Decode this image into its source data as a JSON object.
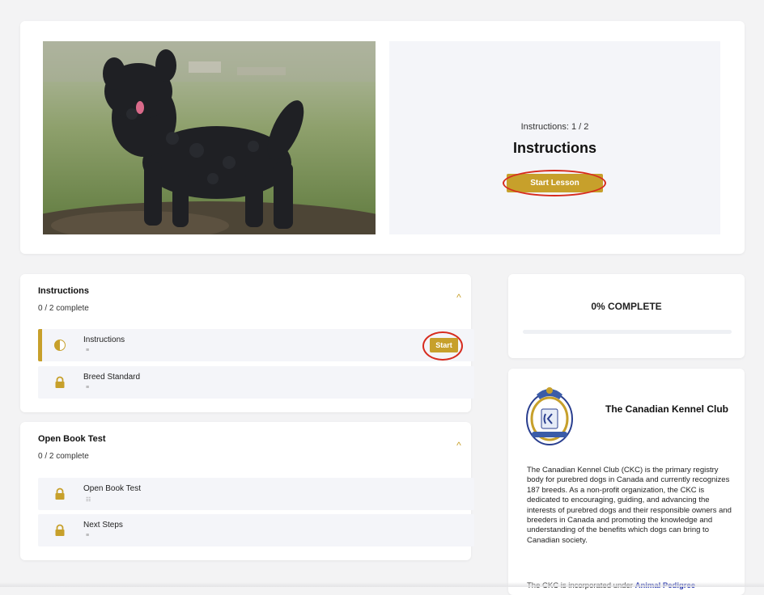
{
  "hero": {
    "image_alt": "curly black dog standing on grassy hillside",
    "lesson_counter": "Instructions: 1 / 2",
    "lesson_title": "Instructions",
    "start_lesson_label": "Start Lesson"
  },
  "sections": [
    {
      "title": "Instructions",
      "count": "0 / 2 complete",
      "items": [
        {
          "title": "Instructions",
          "status_icon": "half-circle-icon",
          "type_icon": "text-lines-icon",
          "type_glyph": "≡",
          "action_label": "Start",
          "active": true
        },
        {
          "title": "Breed Standard",
          "status_icon": "lock-icon",
          "type_icon": "text-lines-icon",
          "type_glyph": "≡"
        }
      ]
    },
    {
      "title": "Open Book Test",
      "count": "0 / 2 complete",
      "items": [
        {
          "title": "Open Book Test",
          "status_icon": "lock-icon",
          "type_icon": "quiz-list-icon",
          "type_glyph": "☷"
        },
        {
          "title": "Next Steps",
          "status_icon": "lock-icon",
          "type_icon": "text-lines-icon",
          "type_glyph": "≡"
        }
      ]
    }
  ],
  "progress": {
    "label": "0% COMPLETE",
    "percent": 0
  },
  "club": {
    "name": "The Canadian Kennel Club",
    "description": "The Canadian Kennel Club (CKC) is the primary registry body for purebred dogs in Canada and currently recognizes 187 breeds. As a non-profit organization, the CKC is dedicated to encouraging, guiding, and advancing the interests of purebred dogs and their responsible owners and breeders in Canada and promoting the knowledge and understanding of the benefits which dogs can bring to Canadian society.",
    "description_more_prefix": "The CKC is incorporated under",
    "description_more_link": "Animal Pedigree"
  },
  "colors": {
    "accent": "#c7a02b",
    "highlight_ring": "#d72b1e",
    "link": "#1a2aa8"
  }
}
